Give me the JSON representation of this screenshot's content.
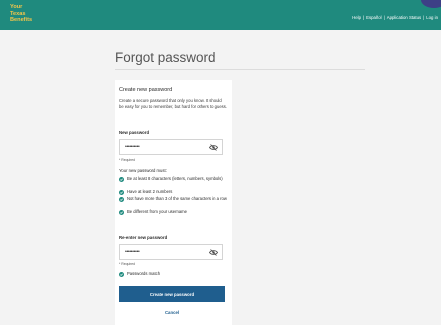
{
  "header": {
    "logo_lines": [
      "Your",
      "Texas",
      "Benefits"
    ],
    "nav": [
      "Help",
      "Español",
      "Application Status",
      "Log in"
    ],
    "separator": "|"
  },
  "page": {
    "title": "Forgot password"
  },
  "form": {
    "heading": "Create new password",
    "description": "Create a secure password that only you know. It should be easy for you to remember, but hard for others to guess.",
    "new_password": {
      "label": "New password",
      "value": "••••••••••",
      "required_note": "* Required"
    },
    "rules_heading": "Your new password must:",
    "rules": [
      "Be at least 8 characters (letters, numbers, symbols)",
      "Have at least 2 numbers",
      "Not have more than 3 of the same characters in a row",
      "Be different from your username"
    ],
    "confirm_password": {
      "label": "Re-enter new password",
      "value": "••••••••••",
      "required_note": "* Required"
    },
    "match_message": "Passwords match",
    "submit_label": "Create new password",
    "cancel_label": "Cancel"
  },
  "colors": {
    "header_bg": "#1f8a7e",
    "logo": "#f3c64a",
    "check": "#1f8a7e",
    "primary": "#1f5e8e"
  },
  "icons": {
    "visibility": "eye-slash-icon",
    "valid": "check-circle-icon"
  }
}
